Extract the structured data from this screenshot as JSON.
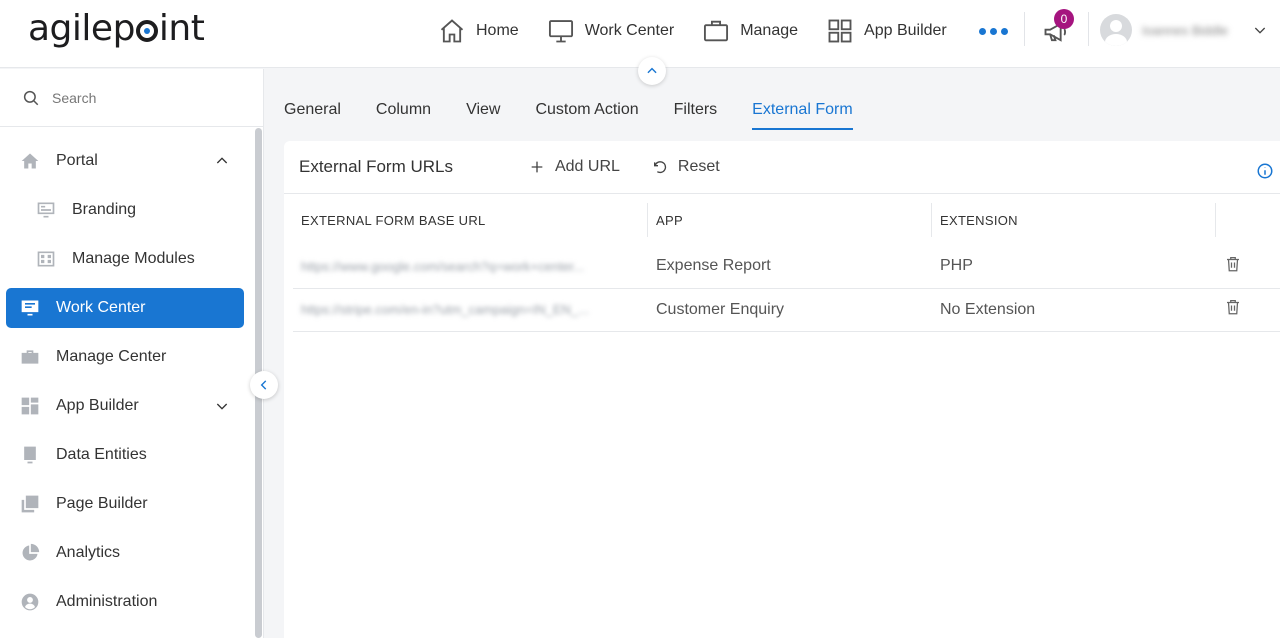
{
  "header": {
    "logo_text": "agilepoint",
    "nav": [
      {
        "label": "Home",
        "icon": "home-icon"
      },
      {
        "label": "Work Center",
        "icon": "monitor-icon"
      },
      {
        "label": "Manage",
        "icon": "briefcase-icon"
      },
      {
        "label": "App Builder",
        "icon": "grid-icon"
      }
    ],
    "more_icon": "more-dots-icon",
    "notifications": {
      "count": "0",
      "icon": "megaphone-icon",
      "badge_color": "#a5147f"
    },
    "user": {
      "name": "Ioannes Biddle",
      "icon": "chevron-down-icon"
    }
  },
  "sidebar": {
    "search_placeholder": "Search",
    "items": [
      {
        "label": "Portal",
        "icon": "home-icon",
        "expanded": true
      },
      {
        "label": "Branding",
        "icon": "branding-icon"
      },
      {
        "label": "Manage Modules",
        "icon": "modules-icon"
      },
      {
        "label": "Work Center",
        "icon": "monitor-icon",
        "active": true
      },
      {
        "label": "Manage Center",
        "icon": "briefcase-icon"
      },
      {
        "label": "App Builder",
        "icon": "grid-icon",
        "expanded": false
      },
      {
        "label": "Data Entities",
        "icon": "database-icon"
      },
      {
        "label": "Page Builder",
        "icon": "pages-icon"
      },
      {
        "label": "Analytics",
        "icon": "pie-icon"
      },
      {
        "label": "Administration",
        "icon": "admin-icon"
      }
    ]
  },
  "tabs": [
    {
      "label": "General"
    },
    {
      "label": "Column"
    },
    {
      "label": "View"
    },
    {
      "label": "Custom Action"
    },
    {
      "label": "Filters"
    },
    {
      "label": "External Form",
      "active": true
    }
  ],
  "panel": {
    "title": "External Form URLs",
    "add_label": "Add URL",
    "reset_label": "Reset",
    "columns": [
      "EXTERNAL FORM BASE URL",
      "APP",
      "EXTENSION"
    ],
    "rows": [
      {
        "url": "https://www.google.com/search?q=work+center...",
        "app": "Expense Report",
        "extension": "PHP"
      },
      {
        "url": "https://stripe.com/en-in?utm_campaign=IN_EN_...",
        "app": "Customer Enquiry",
        "extension": "No Extension"
      }
    ]
  },
  "colors": {
    "accent": "#1976d2",
    "badge": "#a5147f"
  }
}
